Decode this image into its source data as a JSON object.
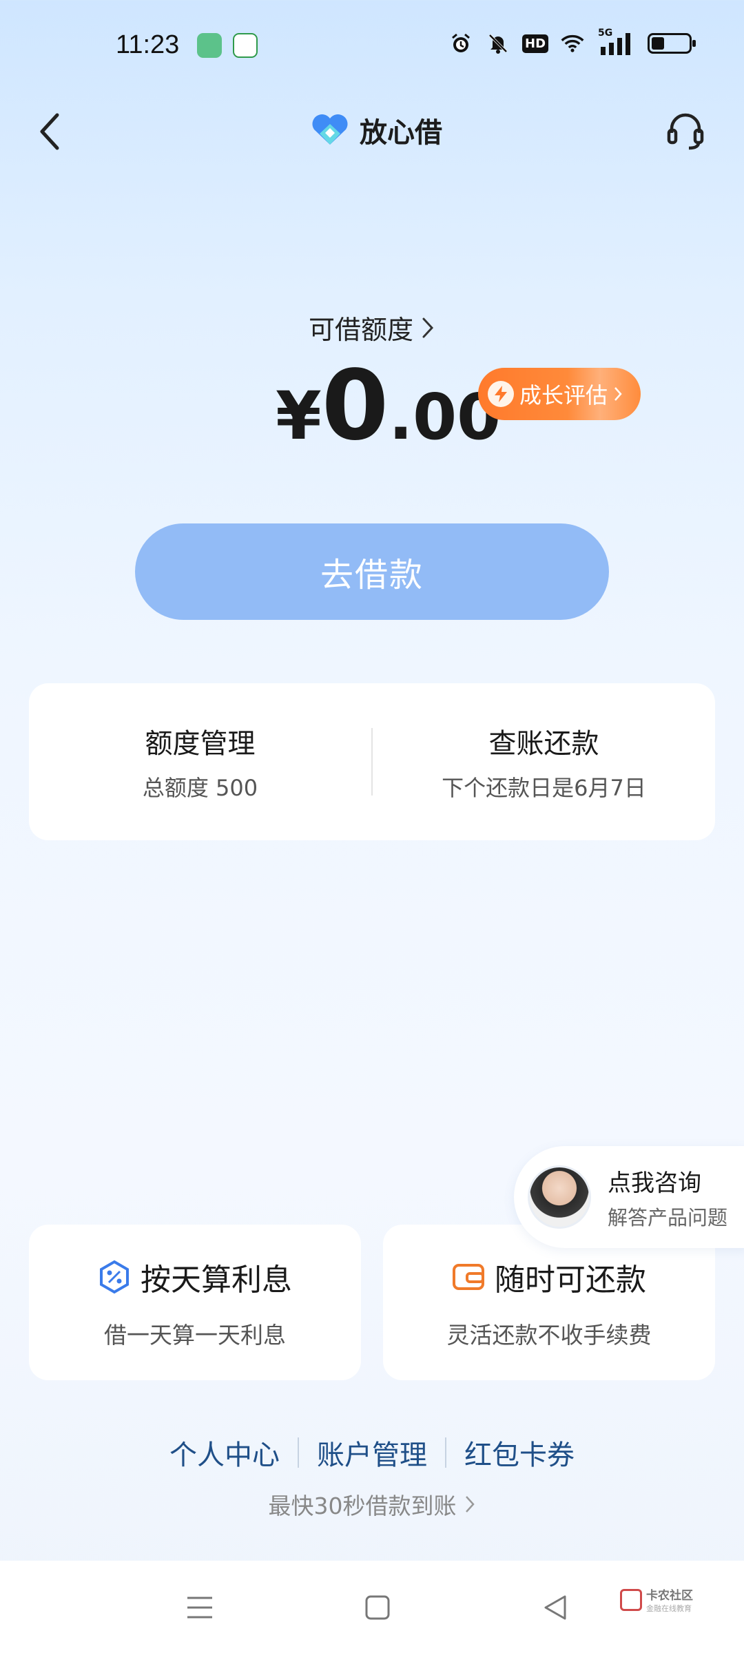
{
  "status_bar": {
    "time": "11:23",
    "network_label": "5G",
    "hd_label": "HD",
    "battery_level": 0.35
  },
  "header": {
    "title": "放心借",
    "back_icon": "chevron-left-icon",
    "support_icon": "headset-icon"
  },
  "credit": {
    "label": "可借额度",
    "currency": "¥",
    "amount_int": "0",
    "amount_dec": ".00",
    "growth_label": "成长评估"
  },
  "borrow_button": {
    "label": "去借款"
  },
  "summary_card": {
    "left": {
      "title": "额度管理",
      "sub": "总额度 500"
    },
    "right": {
      "title": "查账还款",
      "sub": "下个还款日是6月7日"
    }
  },
  "consult": {
    "title": "点我咨询",
    "sub": "解答产品问题"
  },
  "features": [
    {
      "title": "按天算利息",
      "sub": "借一天算一天利息",
      "icon": "percent-hex-icon"
    },
    {
      "title": "随时可还款",
      "sub": "灵活还款不收手续费",
      "icon": "wallet-icon"
    }
  ],
  "links": [
    "个人中心",
    "账户管理",
    "红包卡券"
  ],
  "tagline": "最快30秒借款到账",
  "watermark": {
    "title": "卡农社区",
    "sub": "金融在线教育"
  },
  "colors": {
    "accent": "#92bbf6",
    "badge_orange": "#ff7a2c",
    "link_blue": "#1f4f88"
  }
}
